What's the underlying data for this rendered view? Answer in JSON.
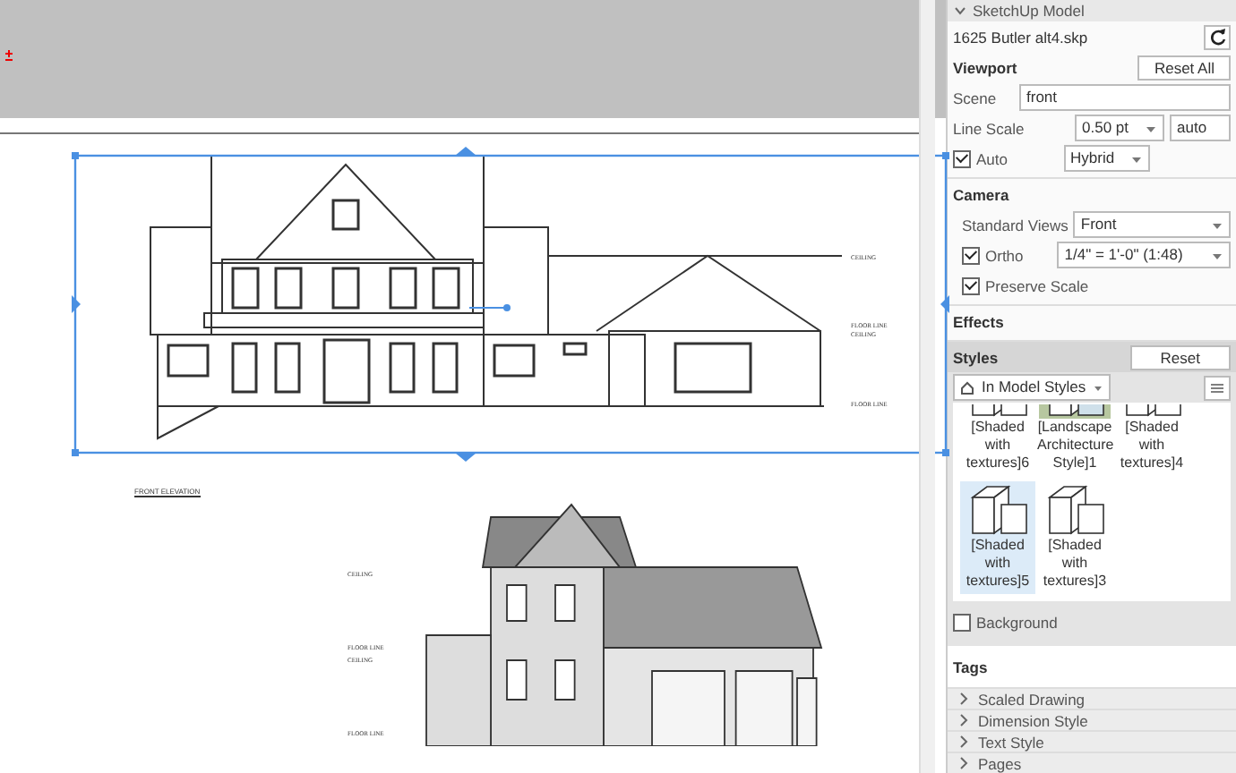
{
  "canvas": {
    "top_labels": [
      "CEILING",
      "FLOOR LINE",
      "CEILING",
      "FLOOR LINE"
    ],
    "caption": "FRONT ELEVATION",
    "bottom_labels": [
      "CEILING",
      "FLOOR LINE",
      "CEILING",
      "FLOOR LINE"
    ]
  },
  "tray": {
    "title": "SketchUp Model",
    "file": "1625 Butler alt4.skp",
    "viewport": {
      "title": "Viewport",
      "reset_button": "Reset All",
      "scene_label": "Scene",
      "scene": "front",
      "line_scale_label": "Line Scale",
      "line_scale": "0.50 pt",
      "line_scale_mode": "auto",
      "auto": {
        "label": "Auto",
        "checked": true
      },
      "auto_mode": "Hybrid"
    },
    "camera": {
      "title": "Camera",
      "standard_views_label": "Standard Views",
      "standard_view": "Front",
      "ortho": {
        "label": "Ortho",
        "checked": true
      },
      "ortho_scale": "1/4\" = 1'-0\" (1:48)",
      "preserve_scale": {
        "label": "Preserve Scale",
        "checked": true
      }
    },
    "effects": {
      "title": "Effects"
    },
    "styles": {
      "title": "Styles",
      "reset_button": "Reset",
      "collection": "In Model Styles",
      "items": [
        {
          "label": "[Shaded with textures]6",
          "kind": "shaded",
          "selected": false
        },
        {
          "label": "[Landscape Architecture Style]1",
          "kind": "landscape",
          "selected": false
        },
        {
          "label": "[Shaded with textures]4",
          "kind": "shaded",
          "selected": false
        },
        {
          "label": "[Shaded with textures]5",
          "kind": "shaded",
          "selected": true
        },
        {
          "label": "[Shaded with textures]3",
          "kind": "shaded",
          "selected": false
        }
      ],
      "background": {
        "label": "Background",
        "checked": false
      }
    },
    "tags": {
      "title": "Tags",
      "items": [
        {
          "label": "Scaled Drawing",
          "expanded": false
        },
        {
          "label": "Dimension Style",
          "expanded": false
        },
        {
          "label": "Text Style",
          "expanded": false
        },
        {
          "label": "Pages",
          "expanded": false
        }
      ]
    }
  }
}
